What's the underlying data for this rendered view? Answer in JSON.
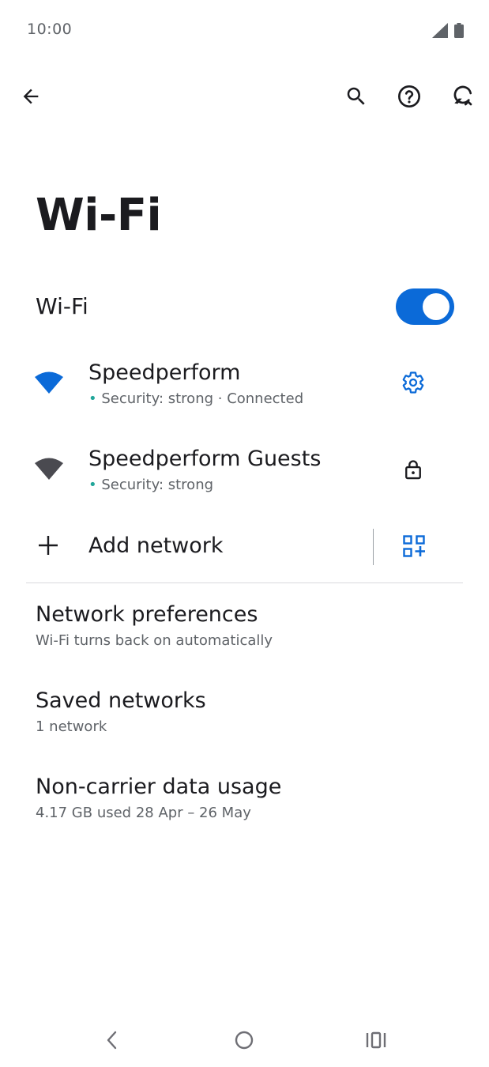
{
  "status_bar": {
    "time": "10:00",
    "icons": [
      "signal-icon",
      "battery-icon"
    ]
  },
  "toolbar": {
    "back_icon": "back-arrow-icon",
    "search_icon": "search-icon",
    "help_icon": "help-icon",
    "reset_icon": "refresh-icon"
  },
  "page": {
    "title": "Wi-Fi"
  },
  "wifi_toggle": {
    "label": "Wi-Fi",
    "enabled": true
  },
  "networks": [
    {
      "name": "Speedperform",
      "dot": "•",
      "status": " Security: strong · Connected",
      "icon": "wifi-connected-icon",
      "action_icon": "gear-icon"
    },
    {
      "name": "Speedperform Guests",
      "dot": "•",
      "status": " Security: strong",
      "icon": "wifi-icon",
      "action_icon": "lock-icon"
    }
  ],
  "add_network": {
    "label": "Add network",
    "icon": "plus-icon",
    "action_icon": "qr-code-icon"
  },
  "preferences": [
    {
      "title": "Network preferences",
      "subtitle": "Wi-Fi turns back on automatically"
    },
    {
      "title": "Saved networks",
      "subtitle": "1 network"
    },
    {
      "title": "Non-carrier data usage",
      "subtitle": "4.17 GB used 28 Apr – 26 May"
    }
  ],
  "nav_bar": {
    "icons": [
      "nav-back-icon",
      "nav-home-icon",
      "nav-recents-icon"
    ]
  },
  "colors": {
    "accent": "#0b6ad8",
    "text_primary": "#1b1b1f",
    "text_secondary": "#5f6368",
    "security_dot": "#22a69a"
  }
}
